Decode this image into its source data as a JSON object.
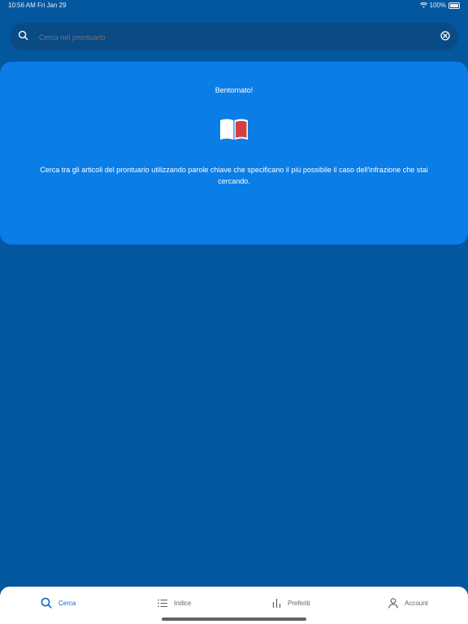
{
  "status_bar": {
    "time": "10:56 AM",
    "date": "Fri Jan 29",
    "battery": "100%"
  },
  "search": {
    "placeholder": "Cerca nel prontuario",
    "value": ""
  },
  "welcome": {
    "title": "Bentornato!",
    "text": "Cerca tra gli articoli del prontuario utilizzando parole chiave che specificano il più possibile il caso dell'infrazione che stai cercando."
  },
  "tabs": [
    {
      "label": "Cerca",
      "icon": "search-icon",
      "active": true
    },
    {
      "label": "Indice",
      "icon": "list-icon",
      "active": false
    },
    {
      "label": "Preferiti",
      "icon": "bar-chart-icon",
      "active": false
    },
    {
      "label": "Account",
      "icon": "person-icon",
      "active": false
    }
  ],
  "colors": {
    "background": "#03579f",
    "card": "#0a7de6",
    "search_bar": "#0a4a85",
    "active_tab": "#1366c4"
  }
}
